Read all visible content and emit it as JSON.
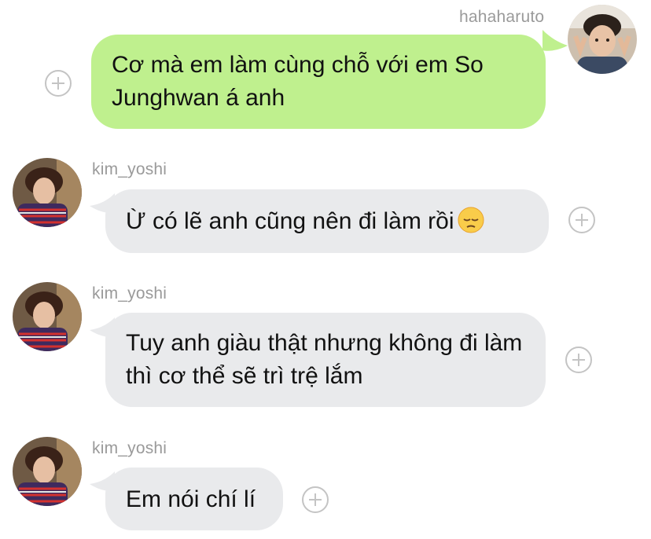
{
  "messages": [
    {
      "sender": "hahaharuto",
      "direction": "outgoing",
      "text": "Cơ mà em làm cùng chỗ với em So Junghwan á anh"
    },
    {
      "sender": "kim_yoshi",
      "direction": "incoming",
      "text": "Ừ có lẽ anh cũng nên đi làm rồi",
      "emoji": "pensive-face"
    },
    {
      "sender": "kim_yoshi",
      "direction": "incoming",
      "text": "Tuy anh giàu thật nhưng không đi làm thì cơ thể sẽ trì trệ lắm"
    },
    {
      "sender": "kim_yoshi",
      "direction": "incoming",
      "text": "Em nói chí lí"
    }
  ],
  "colors": {
    "outgoing_bubble": "#bff08e",
    "incoming_bubble": "#e9eaec",
    "username": "#9a9a9a",
    "plus_icon": "#c4c4c4"
  }
}
